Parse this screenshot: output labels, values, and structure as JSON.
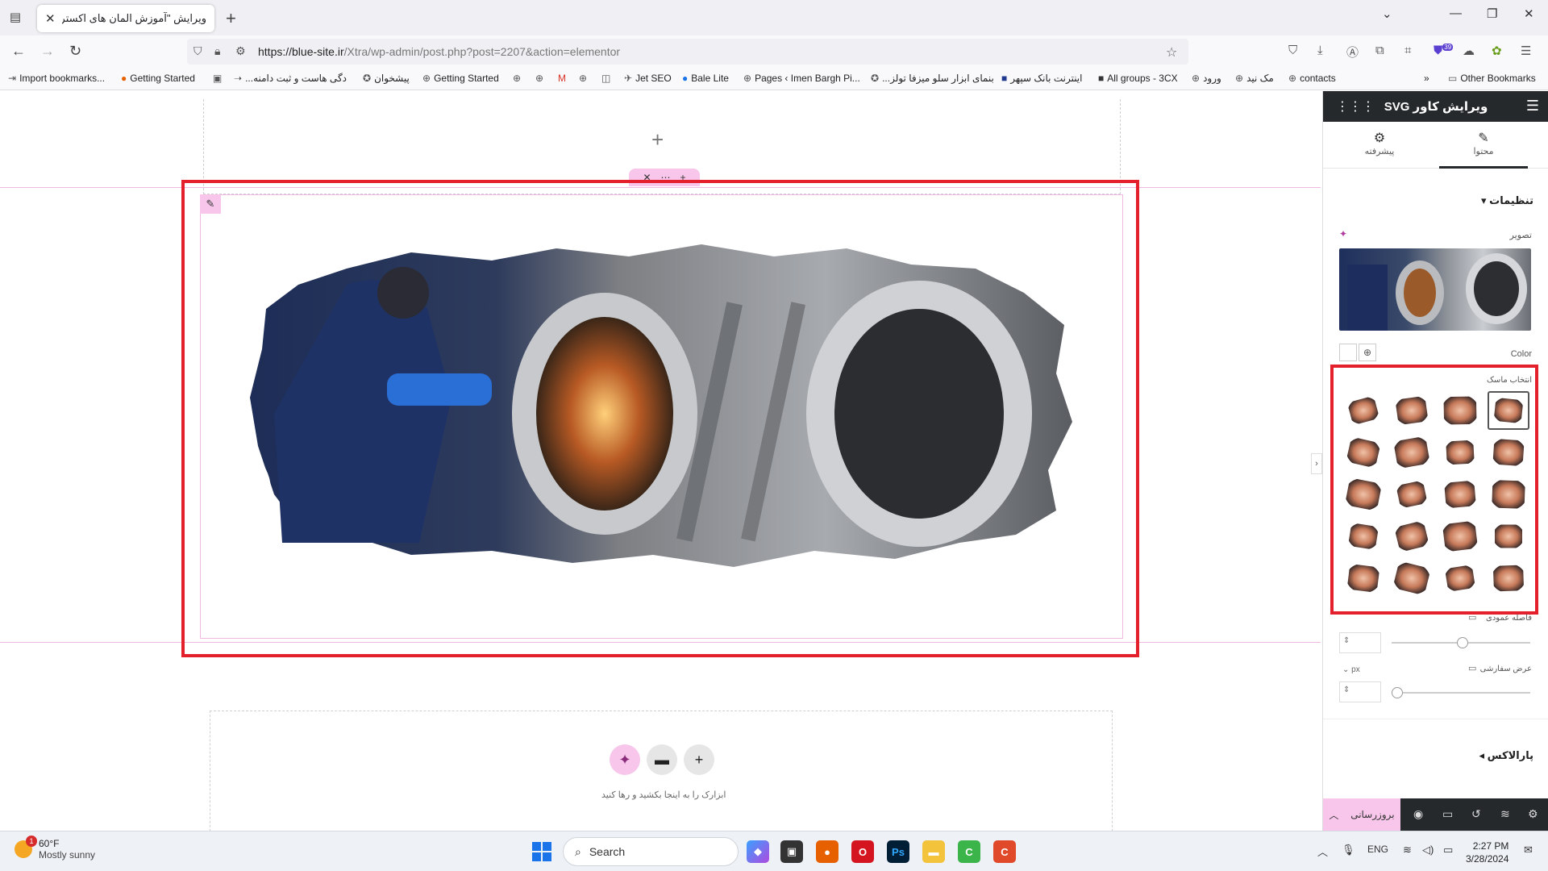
{
  "browser": {
    "tab_title": "ویرایش \"آموزش المان های اکسترا - ما",
    "url_host": "https://blue-site.ir",
    "url_path": "/Xtra/wp-admin/post.php?post=2207&action=elementor",
    "extension_badge": "39",
    "bookmarks": [
      "Import bookmarks...",
      "Getting Started",
      "...دگی هاست و ثبت دامنه",
      "پیشخوان",
      "Getting Started",
      "Jet SEO",
      "Bale Lite",
      "Pages ‹ Imen Bargh Pi...",
      "...بنمای ابزار سلو میزفا تولز",
      "اینترنت بانک سپهر",
      "All groups - 3CX",
      "ورود",
      "مک نید",
      "contacts"
    ],
    "other_bookmarks": "Other Bookmarks"
  },
  "canvas": {
    "drop_hint": "ابزارک را به اینجا بکشید و رها کنید"
  },
  "panel": {
    "title": "ویرایش کاور SVG",
    "tab_content": "محتوا",
    "tab_advanced": "پیشرفته",
    "section_settings": "تنظیمات",
    "image_label": "تصویر",
    "color_label": "Color",
    "mask_label": "انتخاب ماسک",
    "spacing_label": "فاصله عمودی",
    "custom_width_label": "عرض سفارشی",
    "unit": "px",
    "parallax": "پارالاکس",
    "publish": "بروزرسانی",
    "mask_count": 20,
    "selected_mask_index": 3
  },
  "taskbar": {
    "weather_temp": "60°F",
    "weather_desc": "Mostly sunny",
    "weather_badge": "1",
    "search": "Search",
    "lang": "ENG",
    "time": "2:27 PM",
    "date": "3/28/2024"
  },
  "colors": {
    "accent_pink": "#f7c6ea",
    "highlight_red": "#e3202c",
    "panel_dark": "#26292c"
  }
}
